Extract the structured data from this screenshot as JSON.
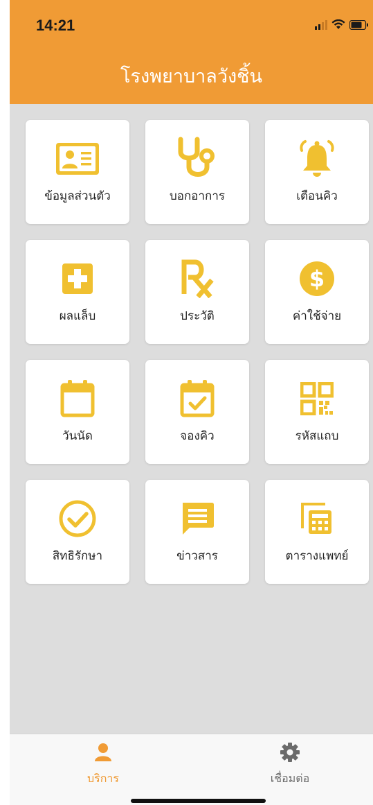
{
  "status": {
    "time": "14:21"
  },
  "app": {
    "title": "โรงพยาบาลวังชิ้น"
  },
  "colors": {
    "header": "#f09b35",
    "icon": "#f0c030",
    "active_tab": "#f09b35",
    "inactive_tab": "#6b6b6b"
  },
  "menu": [
    {
      "label": "ข้อมูลส่วนตัว",
      "icon": "id-card-icon"
    },
    {
      "label": "บอกอาการ",
      "icon": "stethoscope-icon"
    },
    {
      "label": "เตือนคิว",
      "icon": "bell-icon"
    },
    {
      "label": "ผลแล็บ",
      "icon": "medical-plus-icon"
    },
    {
      "label": "ประวัติ",
      "icon": "prescription-rx-icon"
    },
    {
      "label": "ค่าใช้จ่าย",
      "icon": "dollar-coin-icon"
    },
    {
      "label": "วันนัด",
      "icon": "calendar-icon"
    },
    {
      "label": "จองคิว",
      "icon": "calendar-check-icon"
    },
    {
      "label": "รหัสแถบ",
      "icon": "qr-code-icon"
    },
    {
      "label": "สิทธิรักษา",
      "icon": "check-circle-icon"
    },
    {
      "label": "ข่าวสาร",
      "icon": "message-icon"
    },
    {
      "label": "ตารางแพทย์",
      "icon": "calculator-icon"
    }
  ],
  "tabs": [
    {
      "label": "บริการ",
      "icon": "person-icon",
      "active": true
    },
    {
      "label": "เชื่อมต่อ",
      "icon": "gear-icon",
      "active": false
    }
  ]
}
